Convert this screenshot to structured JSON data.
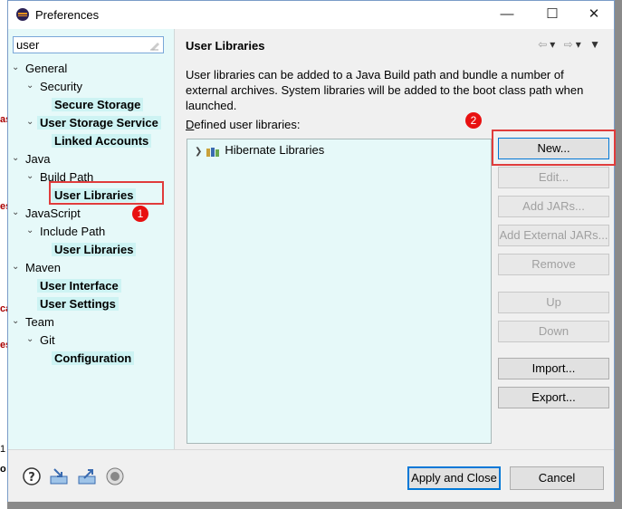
{
  "window": {
    "title": "Preferences",
    "controls": {
      "minimize": "—",
      "maximize": "☐",
      "close": "✕"
    }
  },
  "filter": {
    "value": "user"
  },
  "tree": [
    {
      "label": "General",
      "expanded": true,
      "match": false
    },
    {
      "label": "Security",
      "expanded": true,
      "match": false
    },
    {
      "label": "Secure Storage",
      "match": true
    },
    {
      "label": "User Storage Service",
      "expanded": true,
      "match": true
    },
    {
      "label": "Linked Accounts",
      "match": true
    },
    {
      "label": "Java",
      "expanded": true,
      "match": false
    },
    {
      "label": "Build Path",
      "expanded": true,
      "match": false
    },
    {
      "label": "User Libraries",
      "match": true,
      "selected": true
    },
    {
      "label": "JavaScript",
      "expanded": true,
      "match": false
    },
    {
      "label": "Include Path",
      "expanded": true,
      "match": false
    },
    {
      "label": "User Libraries",
      "match": true
    },
    {
      "label": "Maven",
      "expanded": true,
      "match": false
    },
    {
      "label": "User Interface",
      "match": true
    },
    {
      "label": "User Settings",
      "match": true
    },
    {
      "label": "Team",
      "expanded": true,
      "match": false
    },
    {
      "label": "Git",
      "expanded": true,
      "match": false
    },
    {
      "label": "Configuration",
      "match": true
    }
  ],
  "annotations": {
    "badge1": "1",
    "badge2": "2",
    "color": "#e03c3c"
  },
  "page": {
    "heading": "User Libraries",
    "description": "User libraries can be added to a Java Build path and bundle a number of external archives. System libraries will be added to the boot class path when launched.",
    "defined_label": "Defined user libraries:",
    "libraries": [
      {
        "label": "Hibernate Libraries",
        "icon": "library-icon"
      }
    ]
  },
  "buttons": {
    "new": "New...",
    "edit": "Edit...",
    "add_jars": "Add JARs...",
    "add_external_jars": "Add External JARs...",
    "remove": "Remove",
    "up": "Up",
    "down": "Down",
    "import": "Import...",
    "export": "Export..."
  },
  "footer": {
    "apply_close": "Apply and Close",
    "cancel": "Cancel",
    "icons": [
      "help-icon",
      "import-icon",
      "export-icon",
      "record-icon"
    ]
  },
  "background_marks": [
    "as",
    "es",
    "ca",
    "es",
    "1",
    "o"
  ]
}
